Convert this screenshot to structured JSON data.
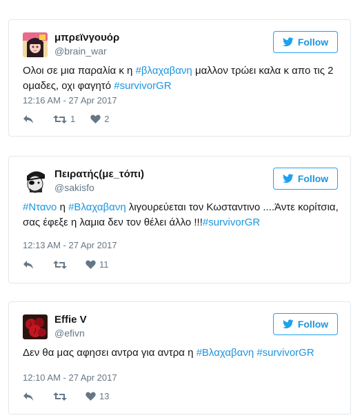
{
  "follow_label": "Follow",
  "tweets": [
    {
      "name": "μπρεϊνγουόρ",
      "handle": "@brain_war",
      "text_parts": [
        {
          "t": "Ολοι σε μια παραλία κ η ",
          "tag": false
        },
        {
          "t": "#βλαχαβανη",
          "tag": true
        },
        {
          "t": " μαλλον τρώει καλα κ απο τις 2 ομαδες, οχι φαγητό ",
          "tag": false
        },
        {
          "t": "#survivorGR",
          "tag": true
        }
      ],
      "time": "12:16 AM - 27 Apr 2017",
      "retweets": "1",
      "likes": "2",
      "avatar_icon": "anime-girl-avatar"
    },
    {
      "name": "Πειρατής(με_τόπι)",
      "handle": "@sakisfo",
      "text_parts": [
        {
          "t": "#Ντανο",
          "tag": true
        },
        {
          "t": " η ",
          "tag": false
        },
        {
          "t": "#Βλαχαβανη",
          "tag": true
        },
        {
          "t": " λιγουρεύεται τον Κωσταντινο ....Άντε κορίτσια, σας έφεξε η λαμια δεν τον θέλει άλλο !!!",
          "tag": false
        },
        {
          "t": "#survivorGR",
          "tag": true
        }
      ],
      "time": "12:13 AM - 27 Apr 2017",
      "retweets": "",
      "likes": "11",
      "avatar_icon": "pirate-avatar"
    },
    {
      "name": "Effie V",
      "handle": "@efivn",
      "text_parts": [
        {
          "t": "Δεν θα μας αφησει αντρα για αντρα η ",
          "tag": false
        },
        {
          "t": "#Βλαχαβανη",
          "tag": true
        },
        {
          "t": " ",
          "tag": false
        },
        {
          "t": "#survivorGR",
          "tag": true
        }
      ],
      "time": "12:10 AM - 27 Apr 2017",
      "retweets": "",
      "likes": "13",
      "avatar_icon": "roses-avatar"
    }
  ],
  "colors": {
    "link": "#1b95e0",
    "follow_border": "#1da1f2",
    "secondary_text": "#657786",
    "card_border": "#e1e8ed"
  }
}
